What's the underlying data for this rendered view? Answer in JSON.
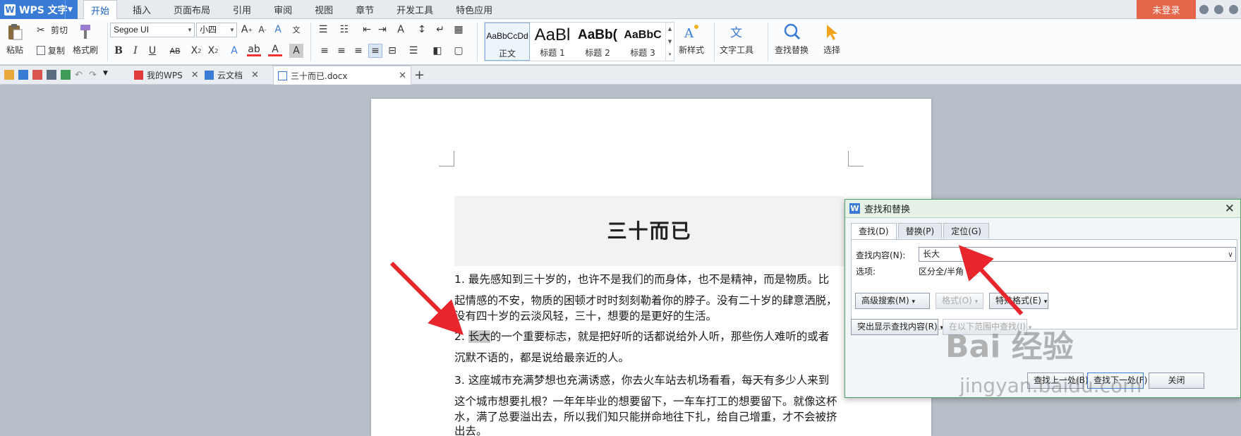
{
  "app": {
    "name": "WPS 文字",
    "logo_letter": "W"
  },
  "menu": {
    "tabs": [
      {
        "label": "开始",
        "active": true
      },
      {
        "label": "插入"
      },
      {
        "label": "页面布局"
      },
      {
        "label": "引用"
      },
      {
        "label": "审阅"
      },
      {
        "label": "视图"
      },
      {
        "label": "章节"
      },
      {
        "label": "开发工具"
      },
      {
        "label": "特色应用"
      }
    ],
    "login": "未登录"
  },
  "ribbon": {
    "paste": "粘贴",
    "cut": "剪切",
    "copy": "复制",
    "format_painter": "格式刷",
    "font_name": "Segoe UI",
    "font_size": "小四",
    "styles": [
      {
        "sample": "AaBbCcDd",
        "name": "正文"
      },
      {
        "sample": "AaBl",
        "name": "标题 1"
      },
      {
        "sample": "AaBb(",
        "name": "标题 2"
      },
      {
        "sample": "AaBbC",
        "name": "标题 3"
      }
    ],
    "new_style": "新样式",
    "text_tools": "文字工具",
    "find_replace": "查找替换",
    "select": "选择"
  },
  "tabs": {
    "my_wps": "我的WPS",
    "cloud_docs": "云文档",
    "current_doc": "三十而已.docx"
  },
  "document": {
    "title": "三十而已",
    "p1": [
      "1. 最先感知到三十岁的，也许不是我们的而身体，也不是精神，而是物质。比",
      "起情感的不安，物质的困顿才时时刻刻勒着你的脖子。没有二十岁的肆意洒脱，",
      "没有四十岁的云淡风轻，三十，想要的是更好的生活。"
    ],
    "p2_prefix": "2. ",
    "p2_highlight": "长大",
    "p2_rest": "的一个重要标志，就是把好听的话都说给外人听，那些伤人难听的或者",
    "p2_line2": "沉默不语的，都是说给最亲近的人。",
    "p3": [
      "3. 这座城市充满梦想也充满诱惑，你去火车站去机场看看，每天有多少人来到",
      "这个城市想要扎根？一年年毕业的想要留下，一车车打工的想要留下。就像这杯",
      "水，满了总要溢出去，所以我们知只能拼命地往下扎，给自己增重，才不会被挤",
      "出去。"
    ]
  },
  "dialog": {
    "title": "查找和替换",
    "tabs": [
      "查找(D)",
      "替换(P)",
      "定位(G)"
    ],
    "find_label": "查找内容(N):",
    "find_value": "长大",
    "options_label": "选项:",
    "options_value": "区分全/半角",
    "advanced": "高级搜索(M)",
    "format": "格式(O)",
    "special": "特殊格式(E)",
    "highlight_all": "突出显示查找内容(R)",
    "find_in": "在以下范围中查找(I)",
    "find_prev": "查找上一处(B)",
    "find_next": "查找下一处(F)",
    "close": "关闭"
  },
  "watermark": {
    "brand": "Bai 经验",
    "url": "jingyan.baidu.com"
  },
  "colors": {
    "accent": "#3a7bd5",
    "login": "#e5664a",
    "arrow": "#e8262b",
    "dialog_border": "#4da36a"
  }
}
